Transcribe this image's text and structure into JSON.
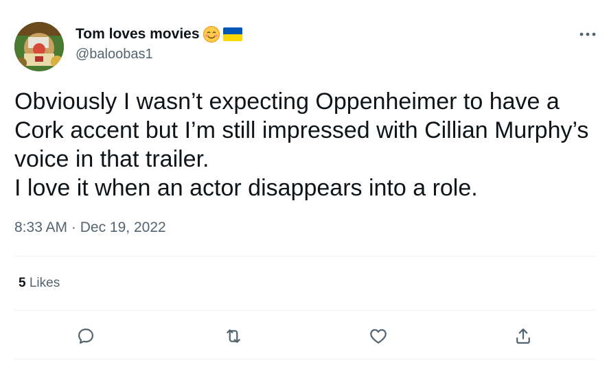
{
  "author": {
    "display_name": "Tom loves movies",
    "handle": "@baloobas1",
    "name_emojis": [
      "smiling-face-with-smiling-eyes-icon",
      "ukraine-flag-icon"
    ]
  },
  "tweet": {
    "text": "Obviously I wasn’t expecting Oppenheimer to have a Cork accent but I’m still impressed with Cillian Murphy’s voice in that trailer.\nI love it when an actor disappears into a role.",
    "time": "8:33 AM",
    "separator": "·",
    "date": "Dec 19, 2022"
  },
  "stats": {
    "likes_count": "5",
    "likes_label": "Likes"
  },
  "actions": {
    "reply": "reply-icon",
    "retweet": "retweet-icon",
    "like": "heart-icon",
    "share": "share-icon"
  },
  "colors": {
    "text": "#0f1419",
    "secondary": "#536471",
    "divider": "#eff3f4"
  }
}
